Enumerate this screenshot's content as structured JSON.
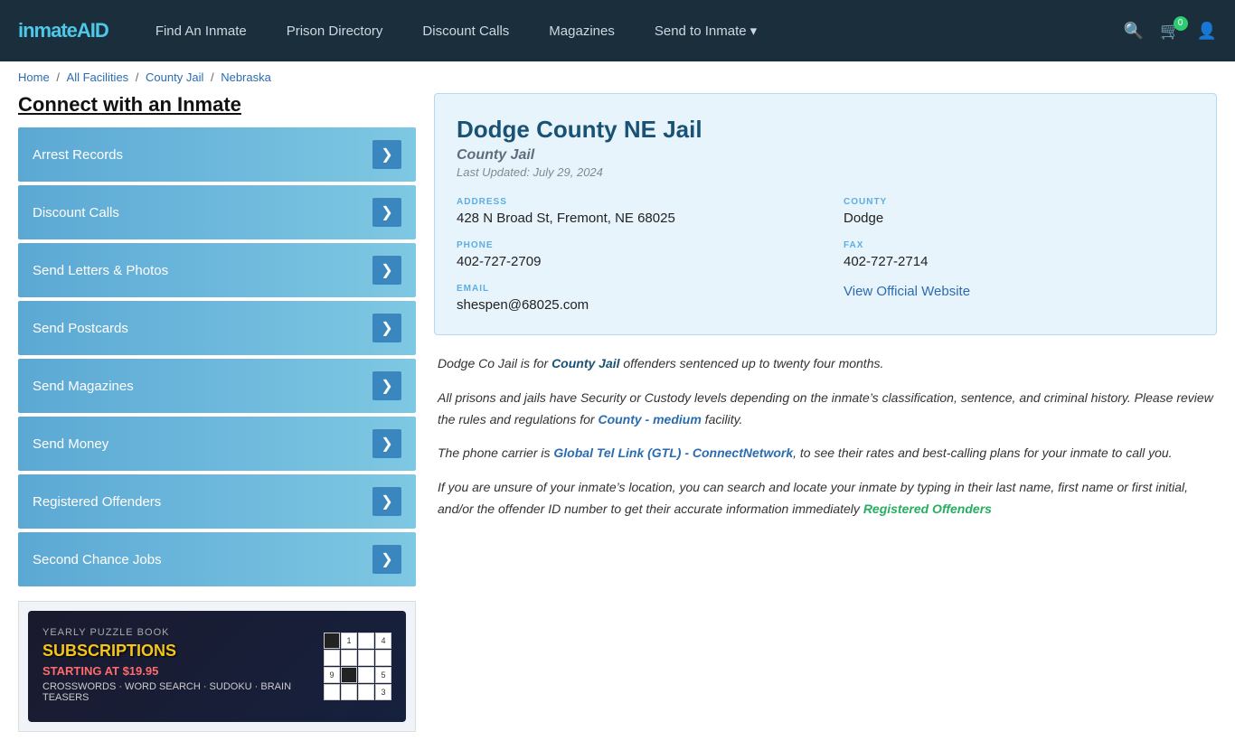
{
  "header": {
    "logo_text": "inmate",
    "logo_accent": "AID",
    "nav": [
      {
        "label": "Find An Inmate",
        "id": "find-inmate"
      },
      {
        "label": "Prison Directory",
        "id": "prison-directory"
      },
      {
        "label": "Discount Calls",
        "id": "discount-calls"
      },
      {
        "label": "Magazines",
        "id": "magazines"
      },
      {
        "label": "Send to Inmate",
        "id": "send-to-inmate",
        "dropdown": true
      }
    ],
    "cart_count": "0"
  },
  "breadcrumb": {
    "items": [
      {
        "label": "Home",
        "href": "#"
      },
      {
        "label": "All Facilities",
        "href": "#"
      },
      {
        "label": "County Jail",
        "href": "#"
      },
      {
        "label": "Nebraska",
        "href": "#"
      }
    ]
  },
  "sidebar": {
    "title": "Connect with an Inmate",
    "buttons": [
      "Arrest Records",
      "Discount Calls",
      "Send Letters & Photos",
      "Send Postcards",
      "Send Magazines",
      "Send Money",
      "Registered Offenders",
      "Second Chance Jobs"
    ]
  },
  "ad": {
    "eyebrow": "YEARLY PUZZLE BOOK",
    "heading": "SUBSCRIPTIONS",
    "subheading": "STARTING AT $19.95",
    "description": "CROSSWORDS · WORD SEARCH · SUDOKU · BRAIN TEASERS"
  },
  "facility": {
    "name": "Dodge County NE Jail",
    "type": "County Jail",
    "last_updated": "Last Updated: July 29, 2024",
    "address_label": "ADDRESS",
    "address_value": "428 N Broad St, Fremont, NE 68025",
    "county_label": "COUNTY",
    "county_value": "Dodge",
    "phone_label": "PHONE",
    "phone_value": "402-727-2709",
    "fax_label": "FAX",
    "fax_value": "402-727-2714",
    "email_label": "EMAIL",
    "email_value": "shespen@68025.com",
    "website_label": "View Official Website",
    "website_href": "#"
  },
  "description": {
    "para1_pre": "Dodge Co Jail is for ",
    "para1_bold": "County Jail",
    "para1_post": " offenders sentenced up to twenty four months.",
    "para2_pre": "All prisons and jails have Security or Custody levels depending on the inmate’s classification, sentence, and criminal history. Please review the rules and regulations for ",
    "para2_bold": "County - medium",
    "para2_post": " facility.",
    "para3_pre": "The phone carrier is ",
    "para3_bold": "Global Tel Link (GTL) - ConnectNetwork",
    "para3_post": ", to see their rates and best-calling plans for your inmate to call you.",
    "para4_pre": "If you are unsure of your inmate’s location, you can search and locate your inmate by typing in their last name, first name or first initial, and/or the offender ID number to get their accurate information immediately ",
    "para4_bold": "Registered Offenders"
  }
}
